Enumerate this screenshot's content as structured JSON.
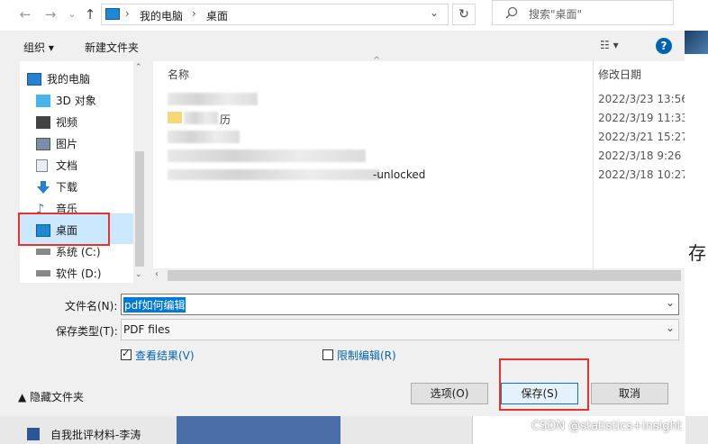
{
  "window": {
    "back_glyph": "←",
    "forward_glyph": "→",
    "dropdown_glyph": "⌄",
    "up_glyph": "↑",
    "refresh_glyph": "↻"
  },
  "address": {
    "segments": [
      "我的电脑",
      "桌面"
    ],
    "separator": "›"
  },
  "search": {
    "placeholder": "搜索\"桌面\""
  },
  "toolbar": {
    "organize": "组织 ▾",
    "new_folder": "新建文件夹",
    "view_glyph": "☷ ▾",
    "help": "?"
  },
  "nav": {
    "items": [
      {
        "label": "我的电脑",
        "icon": "computer-icon"
      },
      {
        "label": "3D 对象",
        "icon": "cube-icon"
      },
      {
        "label": "视频",
        "icon": "video-icon"
      },
      {
        "label": "图片",
        "icon": "picture-icon"
      },
      {
        "label": "文档",
        "icon": "document-icon"
      },
      {
        "label": "下载",
        "icon": "download-icon"
      },
      {
        "label": "音乐",
        "icon": "music-icon"
      },
      {
        "label": "桌面",
        "icon": "desktop-icon"
      },
      {
        "label": "系统 (C:)",
        "icon": "drive-icon"
      },
      {
        "label": "软件 (D:)",
        "icon": "drive-icon"
      }
    ],
    "selected": "桌面"
  },
  "files": {
    "col_name": "名称",
    "col_date": "修改日期",
    "rows": [
      {
        "name_visible": "",
        "date": "2022/3/23 13:56"
      },
      {
        "name_visible": "历",
        "date": "2022/3/19 11:33"
      },
      {
        "name_visible": "",
        "date": "2022/3/21 15:27"
      },
      {
        "name_visible": "",
        "date": "2022/3/18 9:26"
      },
      {
        "name_visible": "-unlocked",
        "date": "2022/3/18 10:27"
      }
    ]
  },
  "form": {
    "filename_label": "文件名(N):",
    "filename_value": "pdf如何编辑",
    "filetype_label": "保存类型(T):",
    "filetype_value": "PDF files",
    "view_result_label": "查看结果(V)",
    "view_result_checked": true,
    "restrict_edit_label": "限制编辑(R)",
    "restrict_edit_checked": false,
    "hide_folders": "▲ 隐藏文件夹",
    "options_button": "选项(O)",
    "save_button": "保存(S)",
    "cancel_button": "取消"
  },
  "background": {
    "taskbar_item": "自我批评材料-李涛",
    "watermark": "CSDN @statistics+insight",
    "side_char": "存"
  },
  "colors": {
    "selection": "#cce8ff",
    "highlight_box": "#e8322c",
    "accent": "#0063b1"
  }
}
